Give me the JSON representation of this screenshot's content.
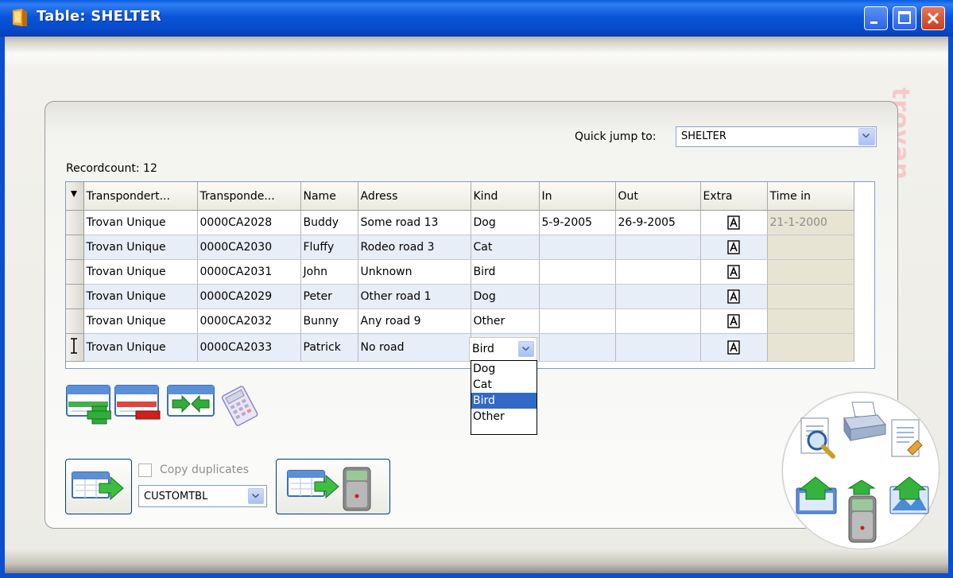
{
  "window": {
    "title": "Table: SHELTER",
    "brand_text": "trovan"
  },
  "quick_jump": {
    "label": "Quick jump to:",
    "value": "SHELTER"
  },
  "recordcount": "Recordcount: 12",
  "grid": {
    "columns": [
      "Transpondert...",
      "Transponde...",
      "Name",
      "Adress",
      "Kind",
      "In",
      "Out",
      "Extra",
      "Time in"
    ],
    "rows": [
      {
        "type": "Trovan Unique",
        "code": "0000CA2028",
        "name": "Buddy",
        "address": "Some road 13",
        "kind": "Dog",
        "in": "5-9-2005",
        "out": "26-9-2005",
        "time_in": "21-1-2000"
      },
      {
        "type": "Trovan Unique",
        "code": "0000CA2030",
        "name": "Fluffy",
        "address": "Rodeo road 3",
        "kind": "Cat",
        "in": "",
        "out": "",
        "time_in": ""
      },
      {
        "type": "Trovan Unique",
        "code": "0000CA2031",
        "name": "John",
        "address": "Unknown",
        "kind": "Bird",
        "in": "",
        "out": "",
        "time_in": ""
      },
      {
        "type": "Trovan Unique",
        "code": "0000CA2029",
        "name": "Peter",
        "address": "Other road 1",
        "kind": "Dog",
        "in": "",
        "out": "",
        "time_in": ""
      },
      {
        "type": "Trovan Unique",
        "code": "0000CA2032",
        "name": "Bunny",
        "address": "Any road 9",
        "kind": "Other",
        "in": "",
        "out": "",
        "time_in": ""
      },
      {
        "type": "Trovan Unique",
        "code": "0000CA2033",
        "name": "Patrick",
        "address": "No road",
        "kind": "",
        "in": "",
        "out": "",
        "time_in": ""
      }
    ]
  },
  "kind_editor": {
    "value": "Bird",
    "options": [
      "Dog",
      "Cat",
      "Bird",
      "Other"
    ],
    "highlighted": "Bird"
  },
  "copy": {
    "checkbox_label": "Copy duplicates",
    "table_value": "CUSTOMTBL"
  },
  "colors": {
    "titlebar": "#0a56d8",
    "selection": "#316ac5",
    "close": "#c7401d"
  },
  "icons": {
    "add_record": "add-record-icon",
    "delete_record": "delete-record-icon",
    "merge": "merge-icon",
    "calculator": "calculator-icon",
    "export": "export-table-icon",
    "export_reader": "export-to-reader-icon",
    "preview": "print-preview-icon",
    "print": "printer-icon",
    "report": "report-icon",
    "import": "import-icon",
    "upload_reader": "upload-reader-icon",
    "import_picture": "import-picture-icon"
  }
}
